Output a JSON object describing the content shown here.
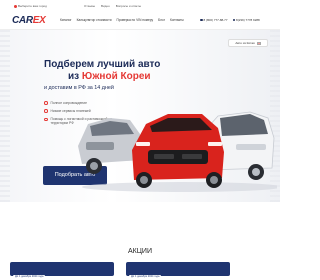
{
  "topbar": {
    "city": "Выберите ваш город",
    "links": [
      "Отзывы",
      "Видео",
      "Вопросы и ответы"
    ]
  },
  "header": {
    "logo": {
      "part1": "CAR",
      "part2": "EX"
    },
    "nav": [
      "Каталог",
      "Калькулятор стоимости",
      "Проверка по VIN номеру",
      "Блог",
      "Контакты"
    ],
    "phones": [
      "8 (800) 777-88-77",
      "8(239) 7778 9288"
    ]
  },
  "hero": {
    "origin_badge": "Авто из Китая",
    "line1": "Подберем лучший авто",
    "line2_prefix": "из ",
    "line2_highlight": "Южной Кореи",
    "line3": "и доставим в РФ за 14 дней",
    "features": [
      "Полное сопровождение",
      "Низкие сервисы платежей",
      "Помощь с логистикой и растаможкой на территории РФ"
    ],
    "cta": "Подобрать авто"
  },
  "promotions": {
    "title": "АКЦИИ",
    "items": [
      {
        "date": "До 1 декабря 2024 года"
      },
      {
        "date": "До 1 декабря 2024 года"
      }
    ]
  },
  "colors": {
    "brand": "#1f3470",
    "accent": "#e53935"
  }
}
